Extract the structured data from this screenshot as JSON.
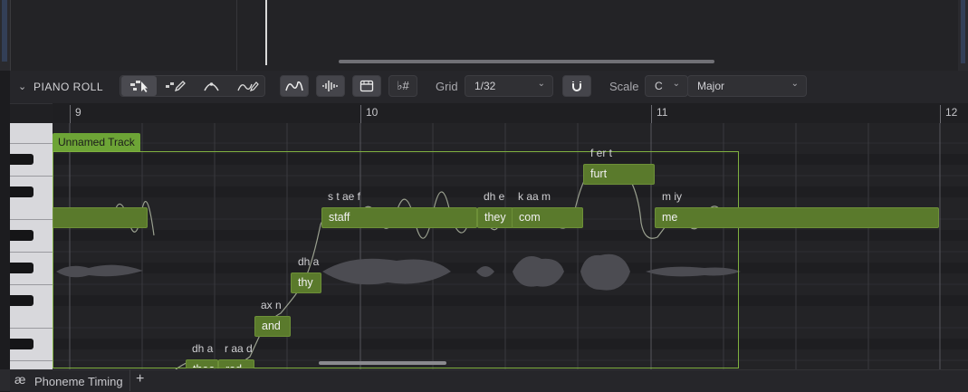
{
  "panel": {
    "title": "PIANO ROLL",
    "collapse_icon": "chevron-down-icon"
  },
  "toolbar": {
    "tools": [
      "select-tool-icon",
      "pencil-tool-icon",
      "pitch-curve-tool-icon",
      "draw-curve-tool-icon"
    ],
    "view_toggles": [
      "pitch-line-icon",
      "waveform-icon",
      "lyrics-icon",
      "accidentals-icon"
    ],
    "accidentals_label": "♭#",
    "grid_label": "Grid",
    "grid_value": "1/32",
    "snap_icon": "magnet-icon",
    "scale_label": "Scale",
    "scale_key": "C",
    "scale_mode": "Major"
  },
  "ruler": {
    "bars": [
      "9",
      "10",
      "11",
      "12"
    ]
  },
  "track": {
    "name": "Unnamed Track",
    "accent": "#6da436",
    "note_color": "#5a7a2c"
  },
  "notes": [
    {
      "lyric": "staff",
      "phonemes": "s t ae f"
    },
    {
      "lyric": "they",
      "phonemes": "dh e"
    },
    {
      "lyric": "com",
      "phonemes": "k aa m"
    },
    {
      "lyric": "furt",
      "phonemes": "f er t"
    },
    {
      "lyric": "me",
      "phonemes": "m iy"
    },
    {
      "lyric": "thy",
      "phonemes": "dh a"
    },
    {
      "lyric": "and",
      "phonemes": "ax n"
    },
    {
      "lyric": "thee",
      "phonemes": "dh a"
    },
    {
      "lyric": "rod",
      "phonemes": "r aa d"
    }
  ],
  "bottom": {
    "tab_icon_glyph": "æ",
    "tab_label": "Phoneme Timing",
    "add_tab": "+"
  }
}
